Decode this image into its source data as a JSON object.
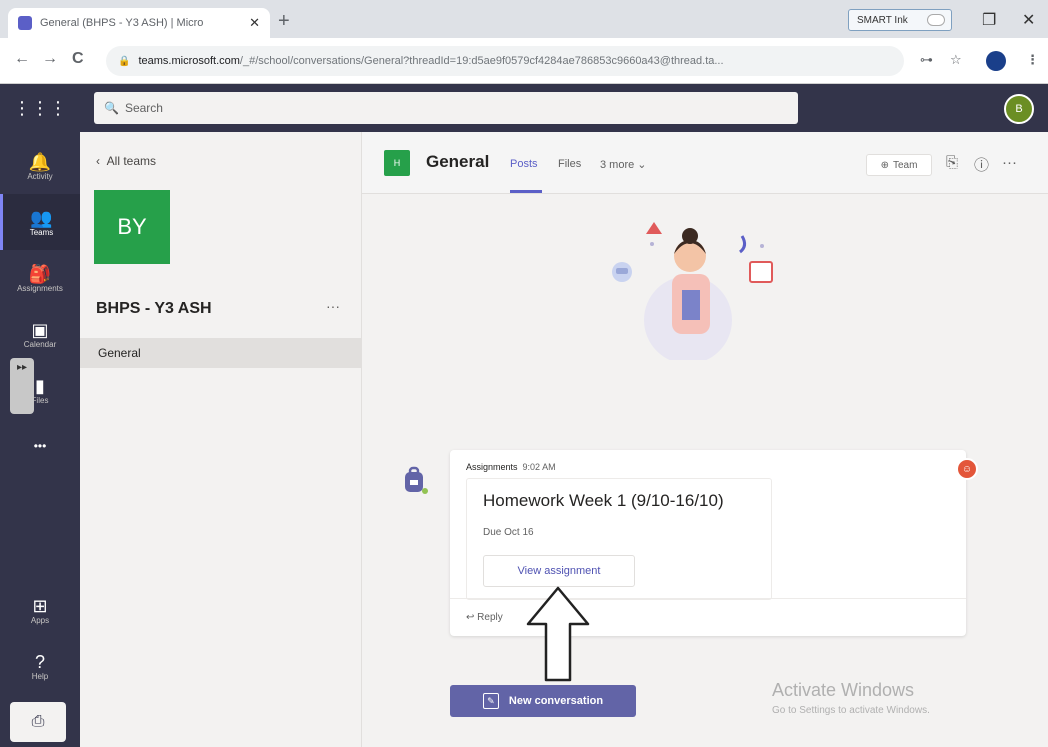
{
  "browser": {
    "tab_title": "General (BHPS - Y3 ASH) | Micro",
    "tab_close": "✕",
    "new_tab": "+",
    "extension_label": "SMART Ink",
    "window_restore": "❐",
    "window_close": "✕",
    "url_host": "teams.microsoft.com",
    "url_path": "/_#/school/conversations/General?threadId=19:d5ae9f0579cf4284ae786853c9660a43@thread.ta...",
    "back": "←",
    "forward": "→",
    "reload": "C",
    "key_icon": "⊶",
    "star_icon": "☆",
    "menu_icon": "⋮"
  },
  "teams": {
    "search_placeholder": "Search",
    "user_initials": "B"
  },
  "rail": {
    "items": [
      {
        "label": "Activity",
        "icon": "bell-icon",
        "glyph": "🔔"
      },
      {
        "label": "Teams",
        "icon": "teams-icon",
        "glyph": "👥"
      },
      {
        "label": "Assignments",
        "icon": "assignments-icon",
        "glyph": "🎒"
      },
      {
        "label": "Calendar",
        "icon": "calendar-icon",
        "glyph": "▣"
      },
      {
        "label": "Files",
        "icon": "files-icon",
        "glyph": "▮"
      },
      {
        "label": "",
        "icon": "more-icon",
        "glyph": "•••"
      },
      {
        "label": "Apps",
        "icon": "apps-icon",
        "glyph": "⊞"
      },
      {
        "label": "Help",
        "icon": "help-icon",
        "glyph": "?"
      }
    ],
    "scroll_glyph": "▸▸",
    "bottom_glyph": "⎙"
  },
  "team_panel": {
    "back_label": "All teams",
    "tile_initials": "BY",
    "team_name": "BHPS - Y3 ASH",
    "more": "···",
    "channels": [
      "General"
    ]
  },
  "channel": {
    "icon_initials": "H",
    "name": "General",
    "tabs": [
      "Posts",
      "Files",
      "3 more ⌄"
    ],
    "team_button": "Team",
    "more": "···"
  },
  "post": {
    "author": "Assignments",
    "time": "9:02 AM",
    "assignment_title": "Homework Week 1 (9/10-16/10)",
    "due": "Due Oct 16",
    "view_button": "View assignment",
    "reply": "Reply"
  },
  "composer": {
    "new_conversation": "New conversation"
  },
  "watermark": {
    "line1": "Activate Windows",
    "line2": "Go to Settings to activate Windows."
  },
  "colors": {
    "teams_purple": "#6264a7",
    "rail_bg": "#33344a",
    "team_green": "#26a04a"
  }
}
